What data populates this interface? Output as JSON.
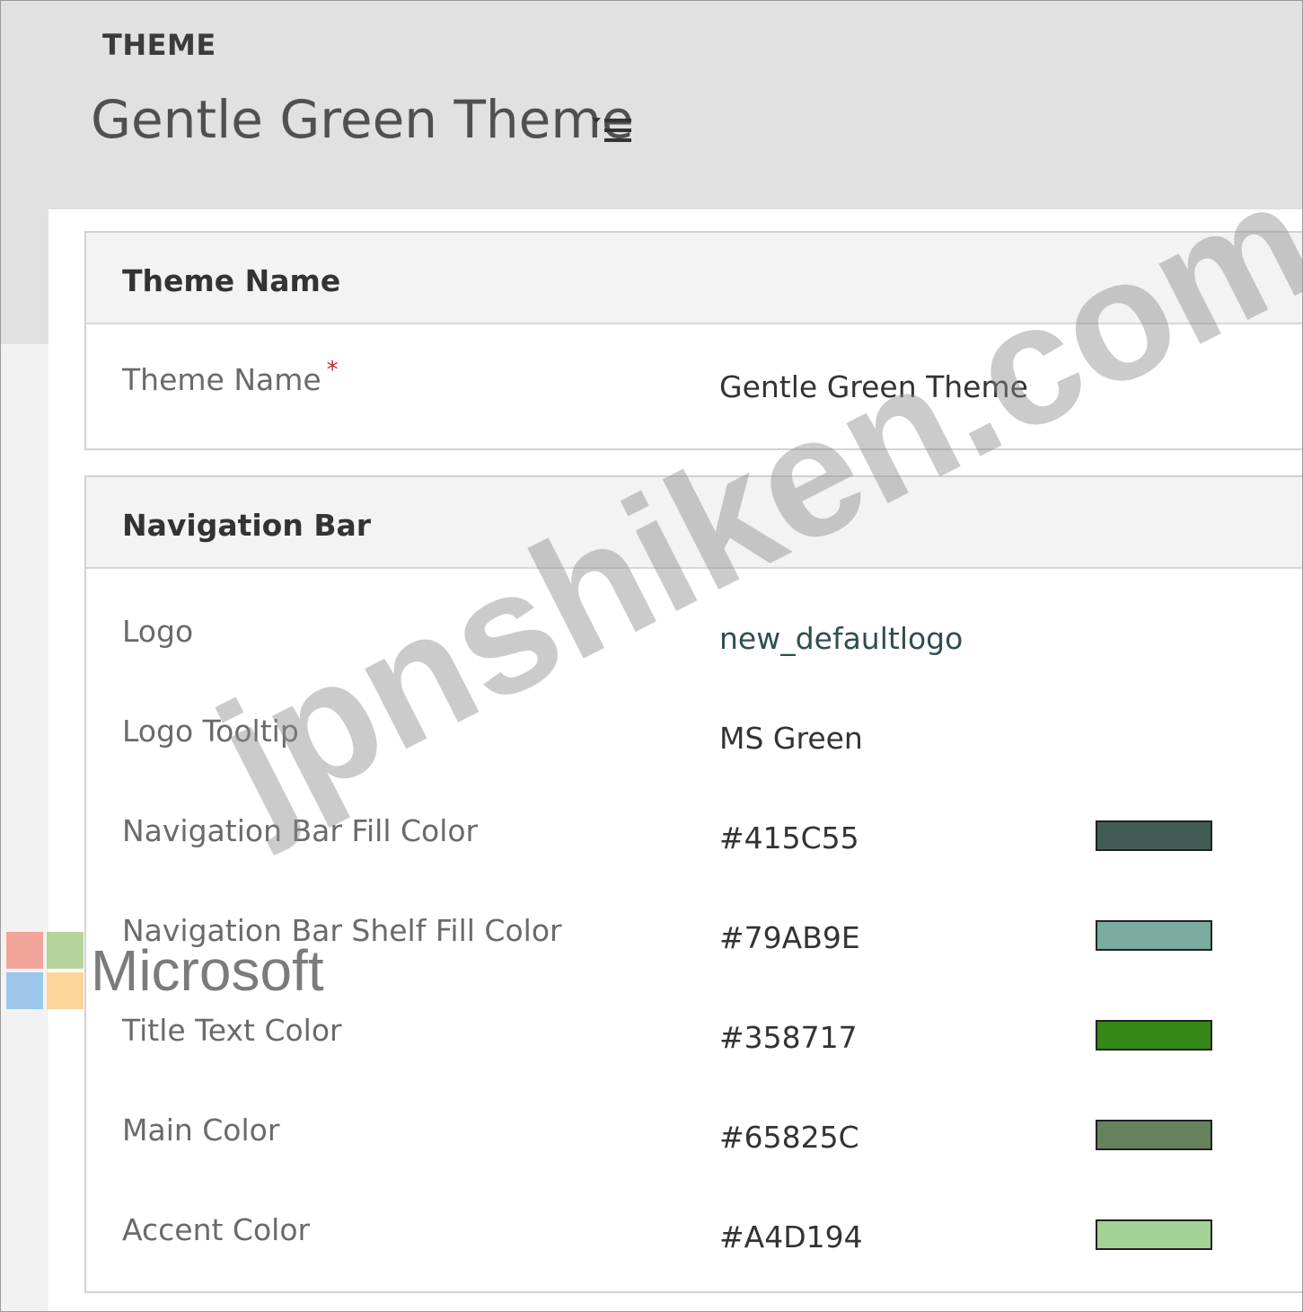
{
  "header": {
    "entity_label": "THEME",
    "record_title": "Gentle Green Theme"
  },
  "sections": {
    "theme_name": {
      "title": "Theme Name",
      "fields": {
        "theme_name": {
          "label": "Theme Name",
          "required_marker": "*",
          "value": "Gentle Green Theme"
        }
      }
    },
    "navigation_bar": {
      "title": "Navigation Bar",
      "fields": {
        "logo": {
          "label": "Logo",
          "value": "new_defaultlogo"
        },
        "logo_tooltip": {
          "label": "Logo Tooltip",
          "value": "MS Green"
        },
        "nav_fill": {
          "label": "Navigation Bar Fill Color",
          "value": "#415C55",
          "swatch": "#415C55"
        },
        "nav_shelf": {
          "label": "Navigation Bar Shelf Fill Color",
          "value": "#79AB9E",
          "swatch": "#79AB9E"
        },
        "title_text": {
          "label": "Title Text Color",
          "value": "#358717",
          "swatch": "#358717"
        },
        "main": {
          "label": "Main Color",
          "value": "#65825C",
          "swatch": "#65825C"
        },
        "accent": {
          "label": "Accent Color",
          "value": "#A4D194",
          "swatch": "#A4D194"
        }
      }
    }
  },
  "overlay": {
    "ms_logo_text": "Microsoft",
    "watermark_text": "jpnshiken.com",
    "ms_colors": [
      "#f1a49a",
      "#b4d49a",
      "#9cc7ea",
      "#fdd59b"
    ]
  }
}
